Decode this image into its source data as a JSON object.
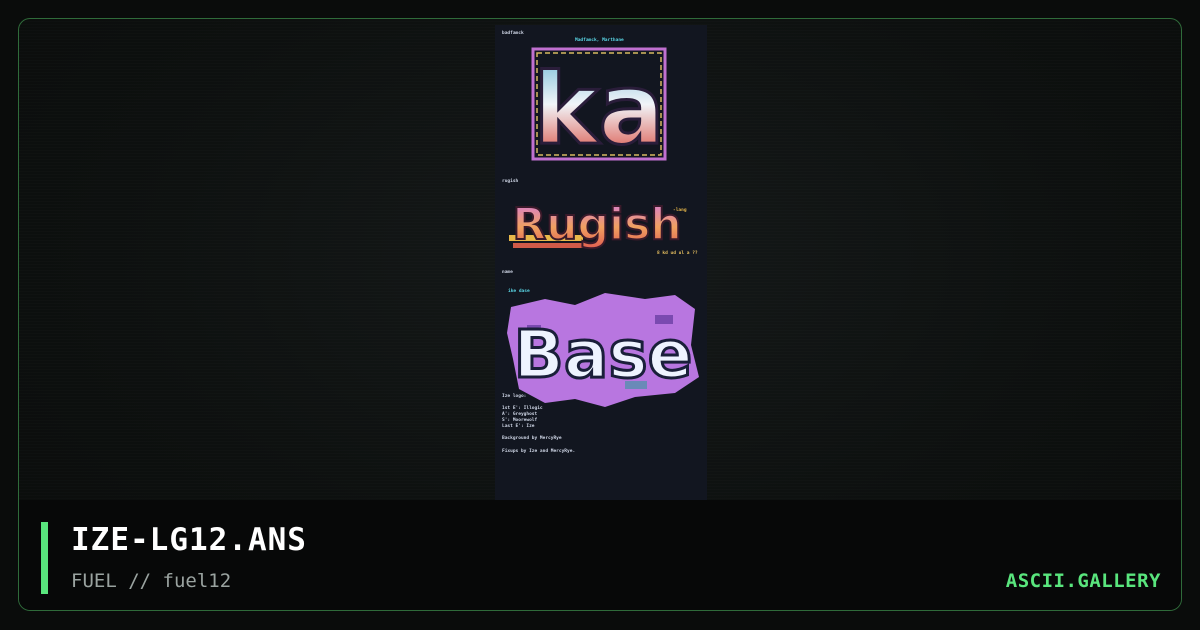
{
  "file": {
    "title": "IZE-LG12.ANS",
    "pack_line": "FUEL // fuel12"
  },
  "brand": {
    "name": "ASCII.GALLERY",
    "color": "#59e57d"
  },
  "artwork": {
    "section1_label": "badfamck",
    "section1_credit": "Madfamck, Marthane",
    "logo1_text": "ka",
    "section2_label": "rugish",
    "logo2_text": "Rugish",
    "logo2_tag": "-lang",
    "logo2_sig": "8 kd ud ul a ??",
    "section3_label": "name",
    "section3_tag": "ike dase",
    "logo3_text": "Base",
    "credits": [
      "Ize logo:",
      "1st E': Illogic",
      "A': Greyghost",
      "S': Moorewolf",
      "Last E': Ize",
      "Background by MercyRye",
      "Fixups by Ize and MercyRye."
    ]
  }
}
